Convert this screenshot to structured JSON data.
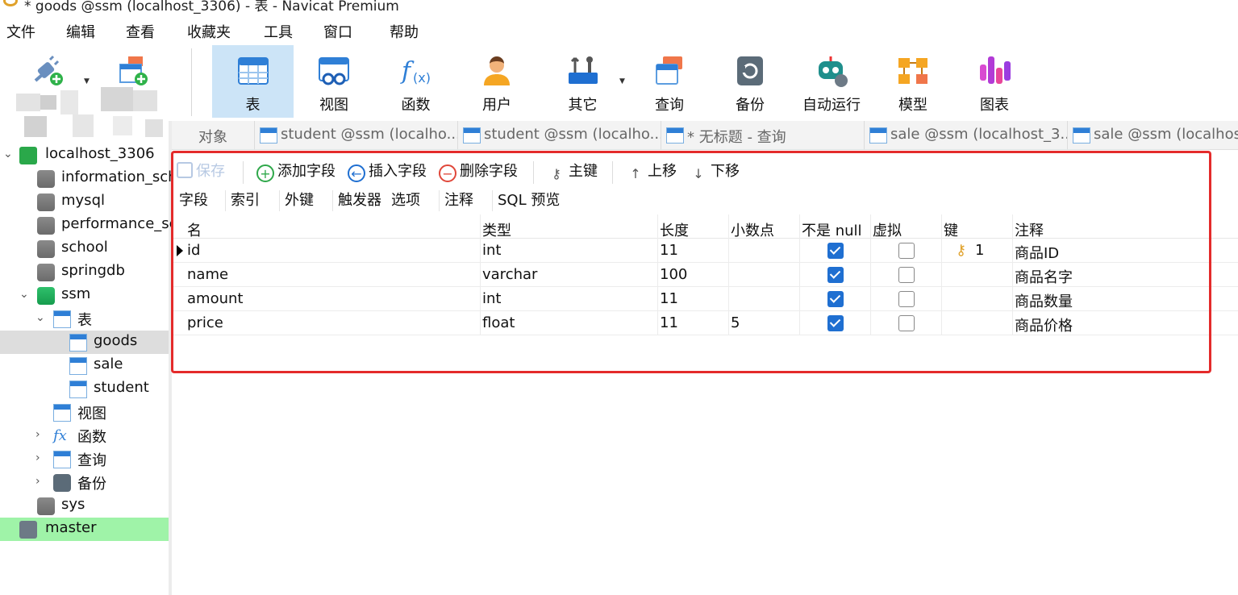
{
  "window": {
    "title": "* goods @ssm (localhost_3306) - 表 - Navicat Premium"
  },
  "menu": [
    "文件",
    "编辑",
    "查看",
    "收藏夹",
    "工具",
    "窗口",
    "帮助"
  ],
  "toolbar": {
    "connection_label": "连接",
    "new_query_label": "新建查询",
    "items": [
      {
        "label": "表",
        "icon": "table-icon",
        "active": true
      },
      {
        "label": "视图",
        "icon": "view-icon"
      },
      {
        "label": "函数",
        "icon": "function-icon"
      },
      {
        "label": "用户",
        "icon": "user-icon"
      },
      {
        "label": "其它",
        "icon": "tools-icon"
      },
      {
        "label": "查询",
        "icon": "query-icon"
      },
      {
        "label": "备份",
        "icon": "backup-icon"
      },
      {
        "label": "自动运行",
        "icon": "robot-icon"
      },
      {
        "label": "模型",
        "icon": "model-icon"
      },
      {
        "label": "图表",
        "icon": "chart-icon"
      }
    ]
  },
  "sidebar": {
    "connection": "localhost_3306",
    "databases": [
      "information_sch",
      "mysql",
      "performance_sc",
      "school",
      "springdb"
    ],
    "ssm": {
      "name": "ssm",
      "tables_label": "表",
      "tables": [
        "goods",
        "sale",
        "student"
      ],
      "views_label": "视图",
      "functions_label": "函数",
      "queries_label": "查询",
      "backup_label": "备份"
    },
    "sys": "sys",
    "master": "master"
  },
  "tabs": [
    {
      "label": "对象"
    },
    {
      "label": "student @ssm (localho..."
    },
    {
      "label": "student @ssm (localho..."
    },
    {
      "label": "* 无标题 - 查询"
    },
    {
      "label": "sale @ssm (localhost_3..."
    },
    {
      "label": "sale @ssm (localhost"
    }
  ],
  "editor_toolbar": {
    "save": "保存",
    "add_field": "添加字段",
    "insert_field": "插入字段",
    "delete_field": "删除字段",
    "primary_key": "主键",
    "move_up": "上移",
    "move_down": "下移"
  },
  "sub_tabs": [
    "字段",
    "索引",
    "外键",
    "触发器",
    "选项",
    "注释",
    "SQL 预览"
  ],
  "columns": [
    "名",
    "类型",
    "长度",
    "小数点",
    "不是 null",
    "虚拟",
    "键",
    "注释"
  ],
  "fields": [
    {
      "name": "id",
      "type": "int",
      "length": "11",
      "decimals": "",
      "not_null": true,
      "virtual": false,
      "key": "1",
      "comment": "商品ID"
    },
    {
      "name": "name",
      "type": "varchar",
      "length": "100",
      "decimals": "",
      "not_null": true,
      "virtual": false,
      "key": "",
      "comment": "商品名字"
    },
    {
      "name": "amount",
      "type": "int",
      "length": "11",
      "decimals": "",
      "not_null": true,
      "virtual": false,
      "key": "",
      "comment": "商品数量"
    },
    {
      "name": "price",
      "type": "float",
      "length": "11",
      "decimals": "5",
      "not_null": true,
      "virtual": false,
      "key": "",
      "comment": "商品价格"
    }
  ],
  "colors": {
    "highlight_frame": "#e42b2b",
    "accent": "#1f6fd1",
    "active_tool": "#cce4f7",
    "master_bg": "#9ff3a8"
  }
}
